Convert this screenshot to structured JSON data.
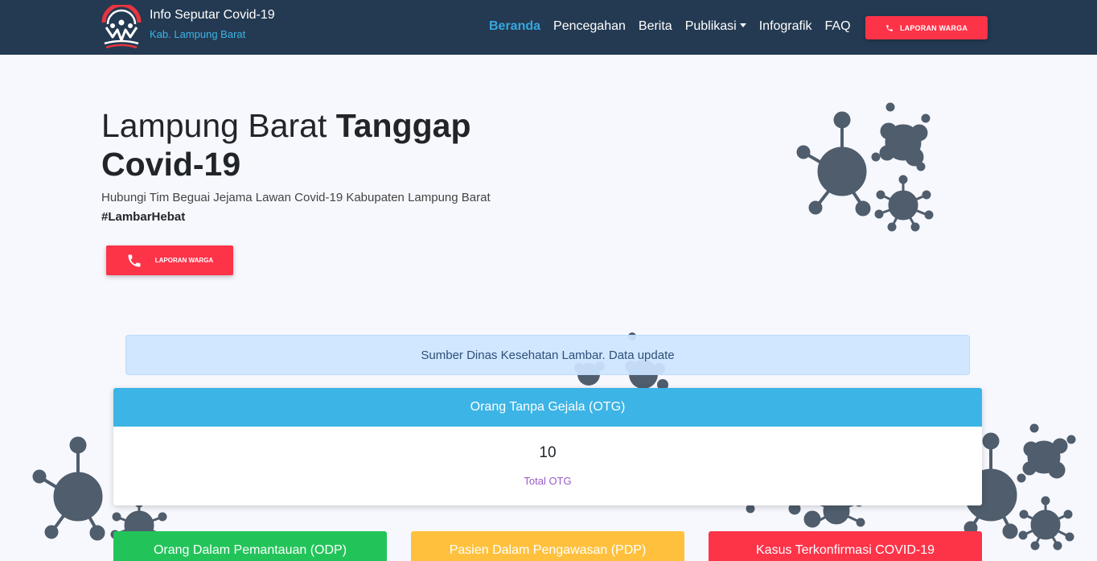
{
  "brand": {
    "title": "Info Seputar Covid-19",
    "subtitle": "Kab. Lampung Barat",
    "logo": "logo-people-icon"
  },
  "nav": {
    "items": [
      {
        "label": "Beranda",
        "active": true
      },
      {
        "label": "Pencegahan"
      },
      {
        "label": "Berita"
      },
      {
        "label": "Publikasi",
        "dropdown": true
      },
      {
        "label": "Infografik"
      },
      {
        "label": "FAQ"
      }
    ],
    "report_button": "LAPORAN WARGA"
  },
  "hero": {
    "title_light": "Lampung Barat ",
    "title_bold1": "Tanggap",
    "title_bold2": "Covid-19",
    "subtitle": "Hubungi Tim Beguai Jejama Lawan Covid-19 Kabupaten Lampung Barat",
    "hashtag": "#LambarHebat",
    "button": "LAPORAN WARGA"
  },
  "alert": {
    "text": "Sumber Dinas Kesehatan Lambar. Data update"
  },
  "otg_card": {
    "title": "Orang Tanpa Gejala (OTG)",
    "value": "10",
    "label": "Total OTG"
  },
  "stat_cards": [
    {
      "title": "Orang Dalam Pemantauan (ODP)"
    },
    {
      "title": "Pasien Dalam Pengawasan (PDP)"
    },
    {
      "title": "Kasus Terkonfirmasi COVID-19"
    }
  ],
  "colors": {
    "navbar": "#243a52",
    "accent_blue": "#36a7e0",
    "red": "#fd3348",
    "green": "#22c45a",
    "yellow": "#ffc13d",
    "otg_head": "#3cb4e5",
    "virus": "#4f5d6d"
  }
}
